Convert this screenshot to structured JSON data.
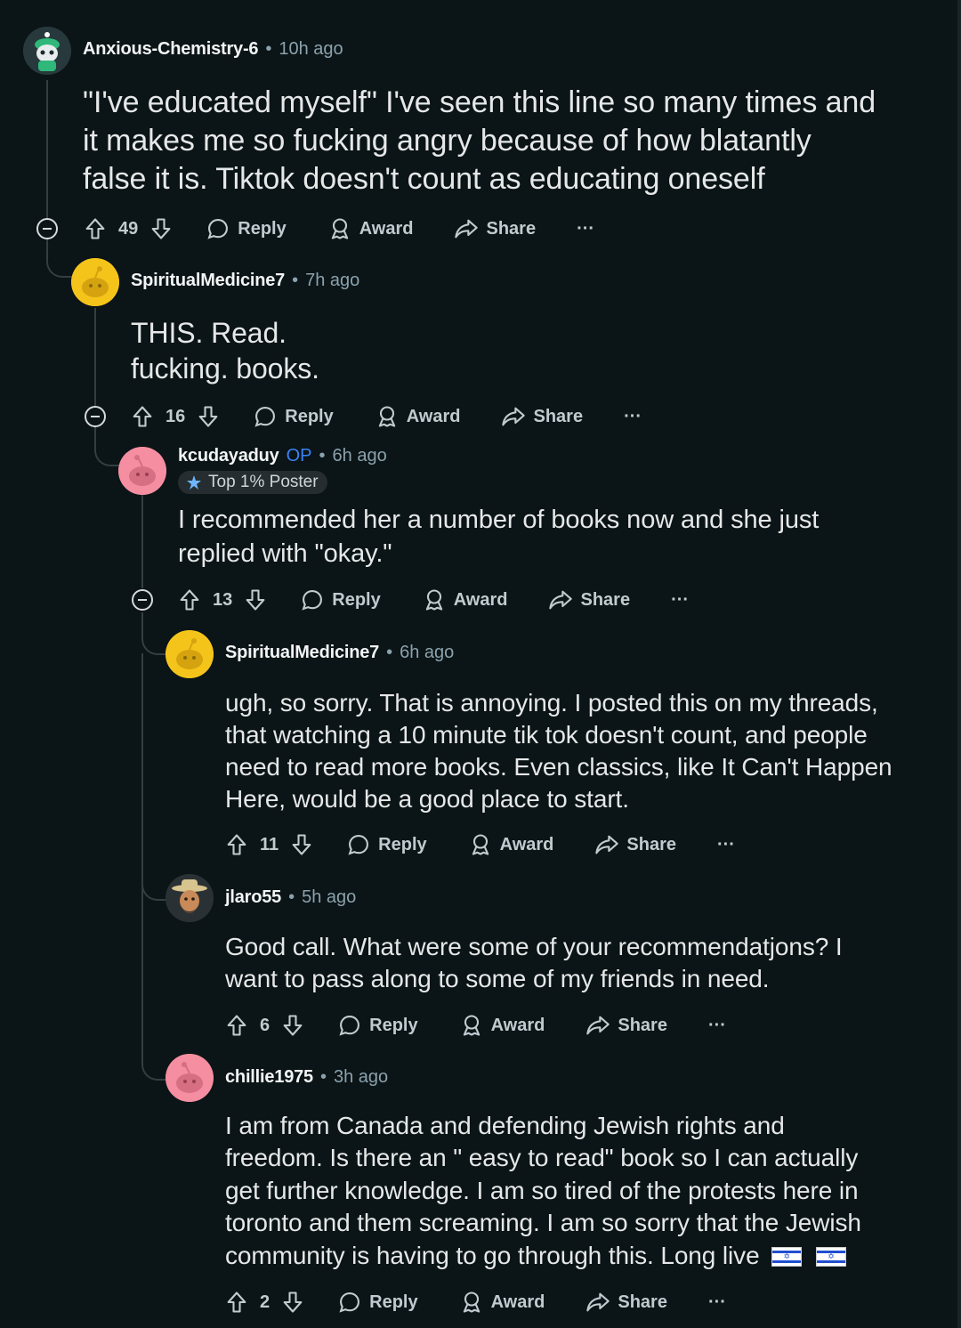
{
  "comments": [
    {
      "username": "Anxious-Chemistry-6",
      "time": "10h ago",
      "lines": [
        "\"I've educated myself\" I've seen this line so many times and",
        "it makes me so fucking angry because of how blatantly",
        "false it is. Tiktok doesn't count as educating oneself"
      ],
      "score": "49"
    },
    {
      "username": "SpiritualMedicine7",
      "time": "7h ago",
      "lines": [
        "THIS. Read.",
        "fucking. books."
      ],
      "score": "16"
    },
    {
      "username": "kcudayaduy",
      "op_label": "OP",
      "flair": "Top 1% Poster",
      "time": "6h ago",
      "lines": [
        "I recommended her a number of books now and she just",
        "replied with \"okay.\""
      ],
      "score": "13"
    },
    {
      "username": "SpiritualMedicine7",
      "time": "6h ago",
      "lines": [
        "ugh, so sorry. That is annoying. I posted this on my threads,",
        "that watching a 10 minute tik tok doesn't count, and people",
        "need to read more books. Even classics, like It Can't Happen",
        "Here, would be a good place to start."
      ],
      "score": "11"
    },
    {
      "username": "jlaro55",
      "time": "5h ago",
      "lines": [
        "Good call. What were some of your recommendatjons? I",
        "want to pass along to some of my friends in need."
      ],
      "score": "6"
    },
    {
      "username": "chillie1975",
      "time": "3h ago",
      "lines": [
        "I am from Canada and defending Jewish rights and",
        "freedom. Is there an \" easy to read\" book so I can actually",
        "get further knowledge. I am so tired of the protests here in",
        "toronto and them screaming. I am so sorry that the Jewish",
        "community is having to go through this. Long live"
      ],
      "score": "2",
      "flag_emoji": "🇮🇱 🇮🇱"
    }
  ],
  "actions": {
    "reply": "Reply",
    "award": "Award",
    "share": "Share",
    "more": "···"
  },
  "separator": "•",
  "icons": {
    "upvote": "upvote-icon",
    "downvote": "downvote-icon",
    "reply": "reply-icon",
    "award": "award-icon",
    "share": "share-icon",
    "more": "more-icon",
    "collapse": "collapse-icon"
  },
  "colors": {
    "background": "#0b1416",
    "op": "#3b82f6",
    "meta": "#8ba2ad",
    "thread_line": "#343d41"
  }
}
